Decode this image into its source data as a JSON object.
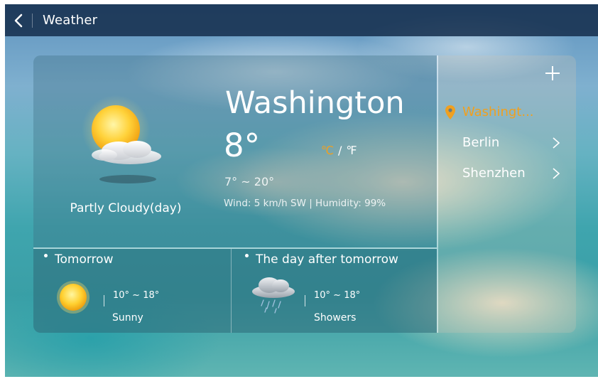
{
  "header": {
    "title": "Weather"
  },
  "current": {
    "city": "Washington",
    "temperature": "8°",
    "unit_c": "℃",
    "unit_sep": "/",
    "unit_f": "℉",
    "range": "7° ~ 20°",
    "details": "Wind: 5 km/h SW | Humidity: 99%",
    "condition": "Partly Cloudy(day)"
  },
  "forecast": [
    {
      "title": "Tomorrow",
      "range": "10° ~ 18°",
      "condition": "Sunny",
      "icon": "sun-icon"
    },
    {
      "title": "The day after tomorrow",
      "range": "10° ~ 18°",
      "condition": "Showers",
      "icon": "rain-cloud-icon"
    }
  ],
  "locations": [
    {
      "label": "Washingt...",
      "active": true
    },
    {
      "label": "Berlin",
      "active": false
    },
    {
      "label": "Shenzhen",
      "active": false
    }
  ],
  "colors": {
    "accent": "#f0a020",
    "topbar": "#142d4b"
  }
}
